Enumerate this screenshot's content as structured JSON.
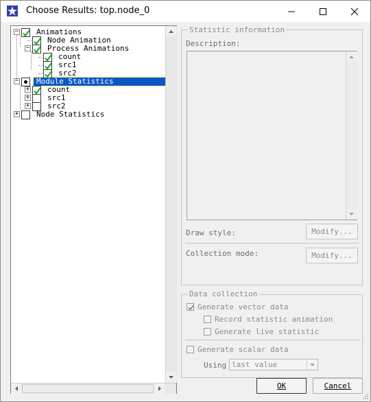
{
  "window": {
    "title": "Choose Results: top.node_0",
    "icon": "star-app-icon",
    "controls": [
      "minimize-icon",
      "maximize-icon",
      "close-icon"
    ]
  },
  "tree": [
    {
      "id": "animations",
      "label": "Animations",
      "level": 0,
      "expander": "−",
      "check": "checked"
    },
    {
      "id": "node-animation",
      "label": "Node Animation",
      "level": 1,
      "expander": null,
      "check": "checked"
    },
    {
      "id": "process-animations",
      "label": "Process Animations",
      "level": 1,
      "expander": "−",
      "check": "checked"
    },
    {
      "id": "pa-count",
      "label": "count",
      "level": 2,
      "expander": null,
      "check": "checked"
    },
    {
      "id": "pa-src1",
      "label": "src1",
      "level": 2,
      "expander": null,
      "check": "checked"
    },
    {
      "id": "pa-src2",
      "label": "src2",
      "level": 2,
      "expander": null,
      "check": "checked"
    },
    {
      "id": "module-statistics",
      "label": "Module Statistics",
      "level": 0,
      "expander": "−",
      "check": "partial",
      "selected": true
    },
    {
      "id": "ms-count",
      "label": "count",
      "level": 1,
      "expander": "+",
      "check": "checked"
    },
    {
      "id": "ms-src1",
      "label": "src1",
      "level": 1,
      "expander": "+",
      "check": "unchecked"
    },
    {
      "id": "ms-src2",
      "label": "src2",
      "level": 1,
      "expander": "+",
      "check": "unchecked"
    },
    {
      "id": "node-statistics",
      "label": "Node Statistics",
      "level": 0,
      "expander": "+",
      "check": "unchecked"
    }
  ],
  "statistic_info": {
    "legend": "Statistic information",
    "description_label": "Description:",
    "draw_style_label": "Draw style:",
    "collection_mode_label": "Collection mode:",
    "modify_label": "Modify..."
  },
  "data_collection": {
    "legend": "Data collection",
    "generate_vector": {
      "label": "Generate vector data",
      "checked": true
    },
    "record_animation": {
      "label": "Record statistic animation",
      "checked": false
    },
    "generate_live": {
      "label": "Generate live statistic",
      "checked": false
    },
    "generate_scalar": {
      "label": "Generate scalar data",
      "checked": false
    },
    "using_label": "Using",
    "using_value": "last value"
  },
  "buttons": {
    "ok": "OK",
    "cancel": "Cancel"
  }
}
